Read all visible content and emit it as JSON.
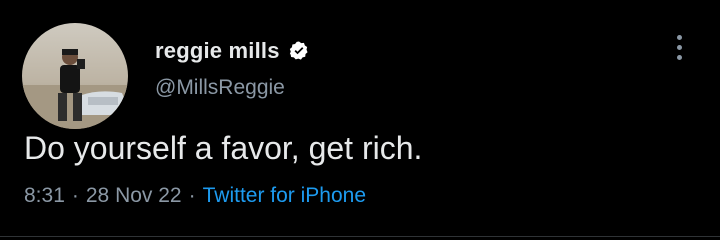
{
  "author": {
    "display_name": "reggie mills",
    "handle": "@MillsReggie",
    "verified": true
  },
  "icons": {
    "avatar": "profile-photo-icon",
    "verified": "verified-badge-icon",
    "more": "more-options-icon"
  },
  "tweet": {
    "text": "Do yourself a favor, get rich."
  },
  "meta": {
    "time": "8:31",
    "separator": "·",
    "date": "28 Nov 22",
    "source": "Twitter for iPhone"
  },
  "colors": {
    "background": "#000000",
    "primary_text": "#e7e9ea",
    "secondary_text": "#8b98a5",
    "link": "#1d9bf0",
    "verified_badge": "#ffffff"
  }
}
